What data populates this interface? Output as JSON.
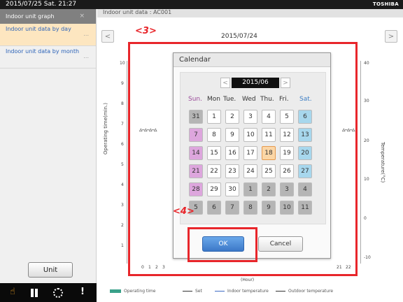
{
  "status_bar": {
    "datetime": "2015/07/25 Sat. 21:27",
    "brand": "TOSHIBA"
  },
  "sidebar": {
    "header": "Indoor unit graph",
    "close_glyph": "×",
    "items": [
      {
        "label": "Indoor unit data by day",
        "more": "...",
        "active": true
      },
      {
        "label": "Indoor unit data by month",
        "more": "..."
      }
    ],
    "unit_button": "Unit"
  },
  "bottom_bar": {
    "icons": [
      "hand-icon",
      "pause-icon",
      "circle-icon",
      "alert-icon"
    ],
    "hand_glyph": "☝",
    "alert_glyph": "!"
  },
  "header": {
    "title": "Indoor unit data : AC001",
    "prev_glyph": "<",
    "next_glyph": ">"
  },
  "graph": {
    "date": "2015/07/24",
    "y_left_label": "Operating time(min.)",
    "y_right_label": "Temperature(°C)",
    "y_left_ticks": [
      "10",
      "9",
      "8",
      "7",
      "6",
      "5",
      "4",
      "3",
      "2",
      "1"
    ],
    "y_right_ticks": [
      "40",
      "30",
      "20",
      "10",
      "0",
      "-10"
    ],
    "x_ticks_left": [
      "0",
      "1",
      "2",
      "3"
    ],
    "x_ticks_right": [
      "21",
      "22"
    ],
    "x_label": "(Hour)",
    "curve_left": "▵–▵–▵–▵",
    "curve_right": "▵–▵–▵"
  },
  "legend": [
    {
      "label": "Operating time",
      "kind": "bar",
      "color": "#3aa18a"
    },
    {
      "label": "Set",
      "kind": "line"
    },
    {
      "label": "Indoor temperature",
      "kind": "line"
    },
    {
      "label": "Outdoor temperature",
      "kind": "line"
    }
  ],
  "annotations": {
    "a3": "<3>",
    "a4": "<4>",
    "color": "#e8262b"
  },
  "calendar_dialog": {
    "title": "Calendar",
    "month": "2015/06",
    "prev_glyph": "<",
    "next_glyph": ">",
    "weekdays": [
      "Sun.",
      "Mon",
      "Tue.",
      "Wed",
      "Thu.",
      "Fri.",
      "Sat."
    ],
    "weeks": [
      [
        "31",
        "1",
        "2",
        "3",
        "4",
        "5",
        "6"
      ],
      [
        "7",
        "8",
        "9",
        "10",
        "11",
        "12",
        "13"
      ],
      [
        "14",
        "15",
        "16",
        "17",
        "18",
        "19",
        "20"
      ],
      [
        "21",
        "22",
        "23",
        "24",
        "25",
        "26",
        "27"
      ],
      [
        "28",
        "29",
        "30",
        "1",
        "2",
        "3",
        "4"
      ],
      [
        "5",
        "6",
        "7",
        "8",
        "9",
        "10",
        "11"
      ]
    ],
    "selected_day": "18",
    "ok_label": "OK",
    "cancel_label": "Cancel"
  }
}
